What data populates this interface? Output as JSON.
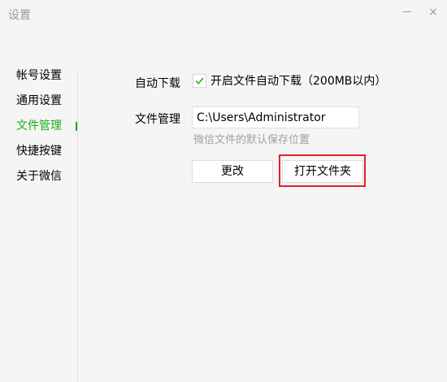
{
  "window": {
    "title": "设置",
    "minimize_glyph": "",
    "close_glyph": "×"
  },
  "sidebar": {
    "items": [
      {
        "label": "帐号设置",
        "active": false
      },
      {
        "label": "通用设置",
        "active": false
      },
      {
        "label": "文件管理",
        "active": true
      },
      {
        "label": "快捷按键",
        "active": false
      },
      {
        "label": "关于微信",
        "active": false
      }
    ]
  },
  "file_management": {
    "auto_download_label": "自动下载",
    "auto_download_checkbox_label": "开启文件自动下载（200MB以内）",
    "auto_download_checked": true,
    "manage_label": "文件管理",
    "path_value": "C:\\Users\\Administrator",
    "path_hint": "微信文件的默认保存位置",
    "change_button_label": "更改",
    "open_folder_button_label": "打开文件夹"
  },
  "colors": {
    "accent": "#1aad19",
    "highlight": "#e0202a",
    "muted_text": "#a0a0a0"
  }
}
